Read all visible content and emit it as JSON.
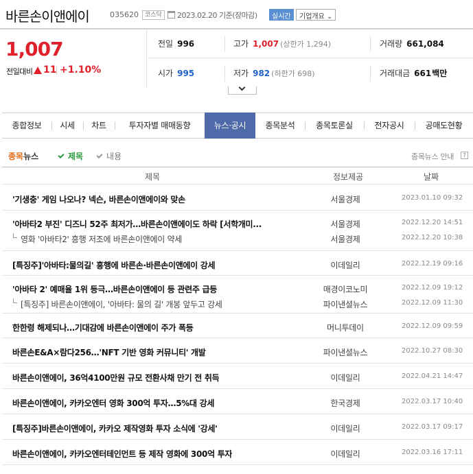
{
  "header": {
    "stock_name": "바른손이앤에이",
    "code": "035620",
    "market": "코스닥",
    "base_date": "2023.02.20 기준(장마감)",
    "realtime_label": "실시간",
    "info_label": "기업개요 ⌄"
  },
  "quote": {
    "price": "1,007",
    "change_label": "전일대비",
    "change_value": "11",
    "change_pct": "+1.10%",
    "prev_close_label": "전일",
    "prev_close": "996",
    "high_label": "고가",
    "high": "1,007",
    "upper_limit": "(상한가 1,294)",
    "volume_label": "거래량",
    "volume": "661,084",
    "open_label": "시가",
    "open": "995",
    "low_label": "저가",
    "low": "982",
    "lower_limit": "(하한가 698)",
    "amount_label": "거래대금",
    "amount": "661",
    "amount_unit": "백만"
  },
  "tabs": [
    "종합정보",
    "시세",
    "차트",
    "투자자별 매매동향",
    "뉴스·공시",
    "종목분석",
    "종목토론실",
    "전자공시",
    "공매도현황"
  ],
  "section": {
    "title_hl": "종목",
    "title_rest": "뉴스",
    "opt_title": "제목",
    "opt_content": "내용",
    "guide": "종목뉴스 안내",
    "help": "?"
  },
  "table": {
    "headers": [
      "제목",
      "정보제공",
      "날짜"
    ],
    "rows": [
      {
        "title": "'기생충' 게임 나오나? 넥슨, 바른손이앤에이와 맞손",
        "source": "서울경제",
        "date": "2023.01.10 09:32"
      },
      {
        "title": "'아바타2 부진' 디즈니 52주 최저가…바른손이앤에이도 하락 [서학개미...",
        "source": "서울경제",
        "date": "2022.12.20 14:51",
        "related": {
          "title": "영화 '아바타2' 흥행 저조에 바른손이앤에이 약세",
          "source": "서울경제",
          "date": "2022.12.20 10:38"
        }
      },
      {
        "title": "[특징주]'아바타:물의길' 흥행에 바른손·바른손이앤에이 강세",
        "source": "이데일리",
        "date": "2022.12.19 09:16"
      },
      {
        "title": "'아바타 2' 예매율 1위 등극…바른손이앤에이 등 관련주 급등",
        "source": "매경이코노미",
        "date": "2022.12.09 19:12",
        "related": {
          "title": "[특징주] 바른손이앤에이, '아바타: 물의 길' 개봉 앞두고 강세",
          "source": "파이낸셜뉴스",
          "date": "2022.12.09 11:30"
        }
      },
      {
        "title": "한한령 해제되나…기대감에 바른손이앤에이 주가 폭등",
        "source": "머니투데이",
        "date": "2022.12.09 09:59"
      },
      {
        "title": "바른손E&A×람다256…'NFT 기반 영화 커뮤니티' 개발",
        "source": "파이낸셜뉴스",
        "date": "2022.10.27 08:30"
      },
      {
        "title": "바른손이앤에이, 36억4100만원 규모 전환사채 만기 전 취득",
        "source": "이데일리",
        "date": "2022.04.21 14:47"
      },
      {
        "title": "바른손이앤에이, 카카오엔터 영화 300억 투자…5%대 강세",
        "source": "한국경제",
        "date": "2022.03.17 10:40"
      },
      {
        "title": "[특징주]바른손이앤에이, 카카오 제작영화 투자 소식에 '강세'",
        "source": "이데일리",
        "date": "2022.03.17 09:17"
      },
      {
        "title": "바른손이앤에이, 카카오엔터테인먼트 등 제작 영화에 300억 투자",
        "source": "이데일리",
        "date": "2022.03.16 17:11"
      }
    ]
  },
  "colors": {
    "up": "#e0212b",
    "down_blue": "#1f62c7",
    "active_tab": "#4e6aa8",
    "check_green": "#2c9a3e",
    "section_orange": "#e56a12"
  }
}
